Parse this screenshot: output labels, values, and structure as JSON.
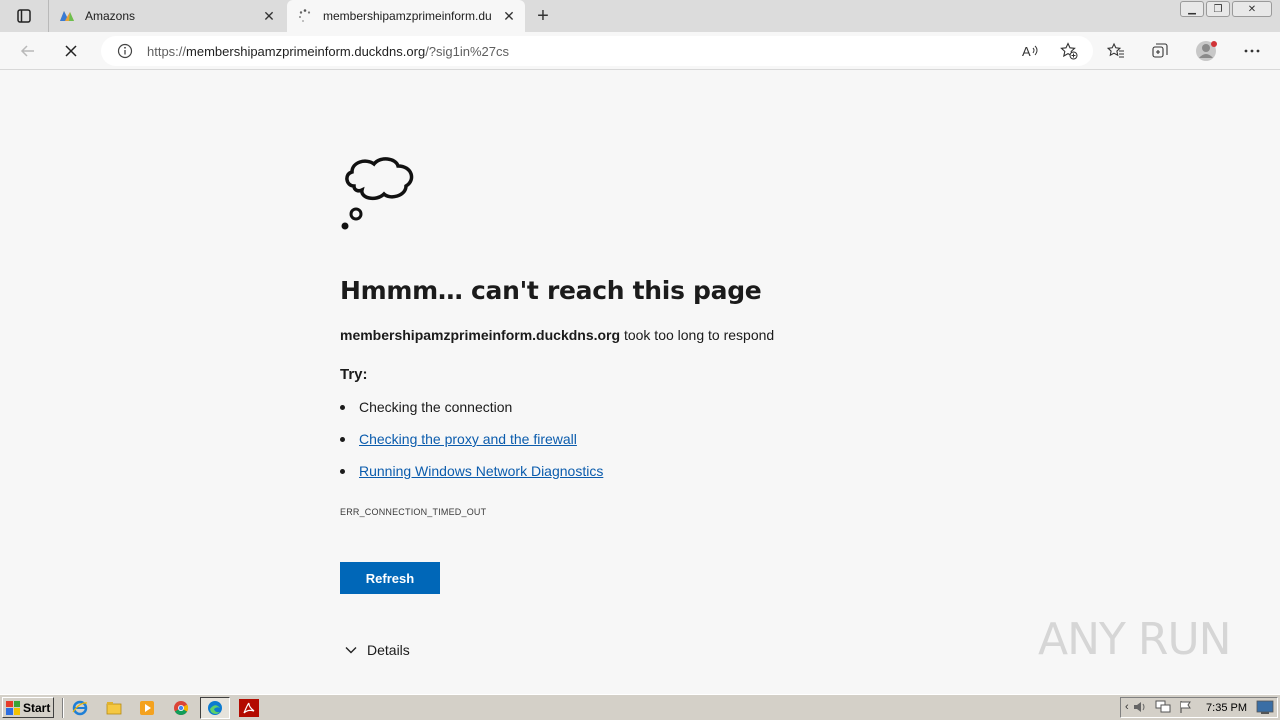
{
  "tabs": [
    {
      "title": "Amazons",
      "icon": "amazons-favicon",
      "active": false
    },
    {
      "title": "membershipamzprimeinform.du",
      "icon": "loading-spinner-icon",
      "active": true
    }
  ],
  "address_bar": {
    "url_prefix": "https://",
    "url_host": "membershipamzprimeinform.duckdns.org",
    "url_path": "/?sig1in%27cs"
  },
  "error_page": {
    "heading": "Hmmm… can't reach this page",
    "host": "membershipamzprimeinform.duckdns.org",
    "message": " took too long to respond",
    "try_label": "Try:",
    "suggestions": [
      {
        "text": "Checking the connection",
        "link": false
      },
      {
        "text": "Checking the proxy and the firewall",
        "link": true
      },
      {
        "text": "Running Windows Network Diagnostics",
        "link": true
      }
    ],
    "error_code": "ERR_CONNECTION_TIMED_OUT",
    "refresh_label": "Refresh",
    "details_label": "Details"
  },
  "watermark": {
    "text": "ANY RUN"
  },
  "taskbar": {
    "start_label": "Start",
    "clock": "7:35 PM"
  },
  "colors": {
    "accent": "#0067b8",
    "link": "#0b5cad"
  }
}
